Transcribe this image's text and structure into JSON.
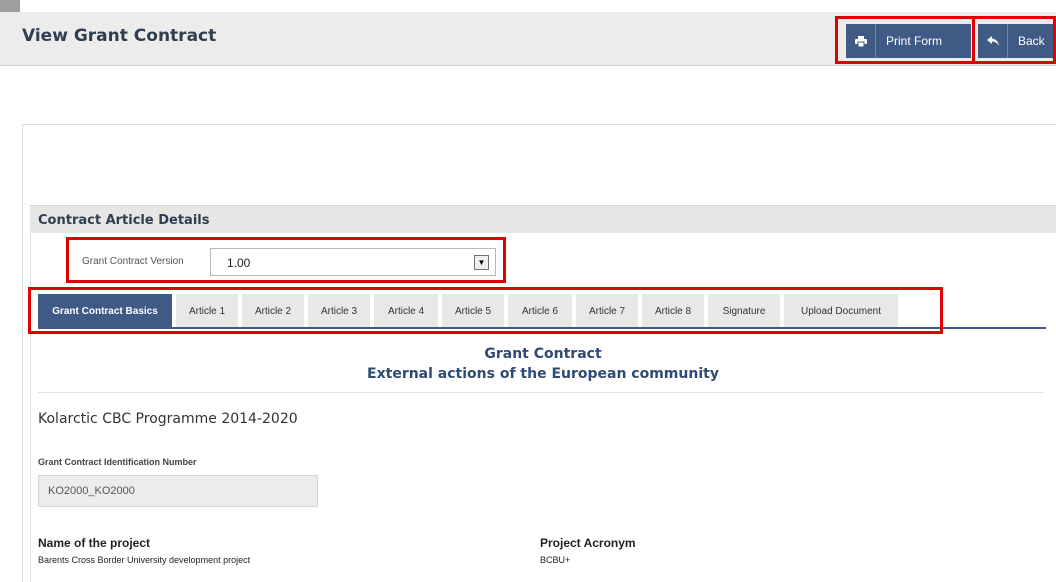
{
  "page": {
    "title": "View Grant Contract"
  },
  "toolbar": {
    "print_label": "Print Form",
    "back_label": "Back",
    "print_icon": "printer-icon",
    "back_icon": "reply-arrow-icon"
  },
  "section": {
    "title": "Contract Article Details"
  },
  "version": {
    "label": "Grant Contract Version",
    "value": "1.00"
  },
  "tabs": [
    {
      "label": "Grant Contract Basics",
      "active": true
    },
    {
      "label": "Article 1"
    },
    {
      "label": "Article 2"
    },
    {
      "label": "Article 3"
    },
    {
      "label": "Article 4"
    },
    {
      "label": "Article 5"
    },
    {
      "label": "Article 6"
    },
    {
      "label": "Article 7"
    },
    {
      "label": "Article 8"
    },
    {
      "label": "Signature"
    },
    {
      "label": "Upload Document"
    }
  ],
  "contract": {
    "title_line1": "Grant Contract",
    "title_line2": "External actions of the European community",
    "programme": "Kolarctic CBC Programme 2014-2020",
    "id_label": "Grant Contract Identification Number",
    "id_value": "KO2000_KO2000",
    "project_name_label": "Name of the project",
    "project_name_value": "Barents Cross Border University development project",
    "acronym_label": "Project Acronym",
    "acronym_value": "BCBU+"
  },
  "colors": {
    "accent": "#3f5a85",
    "highlight": "#e00000",
    "title_text": "#2f4b73"
  }
}
